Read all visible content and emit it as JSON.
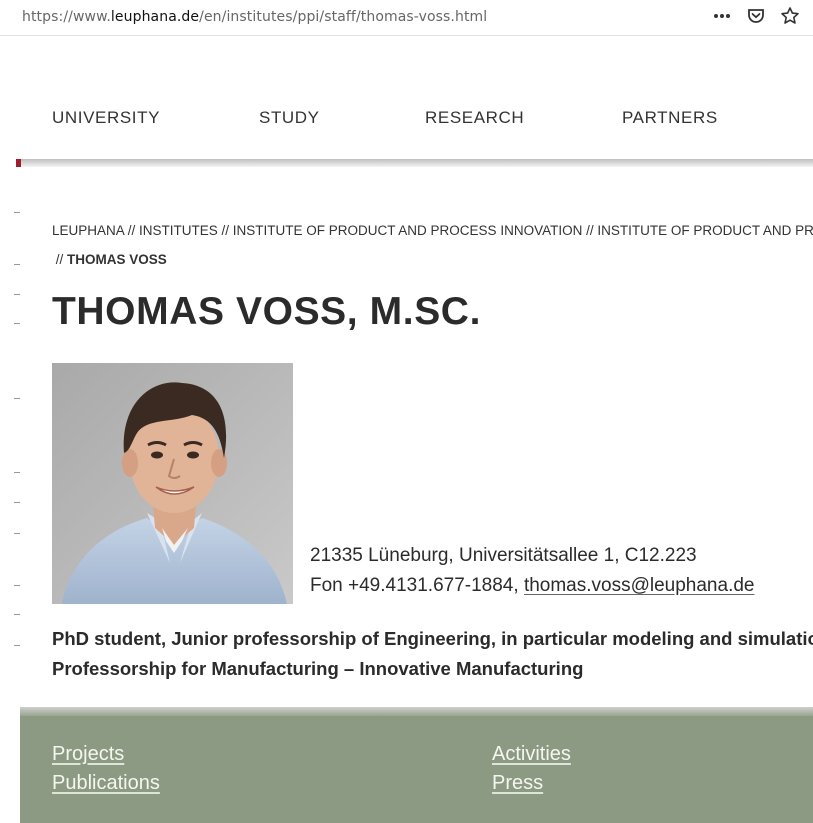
{
  "browser": {
    "url_prefix": "https://www.",
    "url_host": "leuphana.de",
    "url_path": "/en/institutes/ppi/staff/thomas-voss.html",
    "icons": [
      "more-icon",
      "pocket-icon",
      "bookmark-star-icon"
    ]
  },
  "nav": {
    "items": [
      "UNIVERSITY",
      "STUDY",
      "RESEARCH",
      "PARTNERS"
    ]
  },
  "breadcrumb": {
    "line1": "LEUPHANA // INSTITUTES // INSTITUTE OF PRODUCT AND PROCESS INNOVATION // INSTITUTE OF PRODUCT AND PROCESS",
    "separator": "// ",
    "current": "THOMAS VOSS"
  },
  "profile": {
    "name": "THOMAS VOSS, M.SC.",
    "address": "21335 Lüneburg, Universitätsallee 1, C12.223",
    "phone": "Fon +49.4131.677-1884, ",
    "email": "thomas.voss@leuphana.de",
    "role_line1": "PhD student, Junior professorship of Engineering, in particular modeling and simulatio",
    "role_line2": "Professorship for Manufacturing – Innovative Manufacturing"
  },
  "footer_links": {
    "projects": "Projects",
    "publications": "Publications",
    "activities": "Activities",
    "press": "Press"
  },
  "colors": {
    "accent": "#a31c2c",
    "panel": "#8c9a83"
  }
}
